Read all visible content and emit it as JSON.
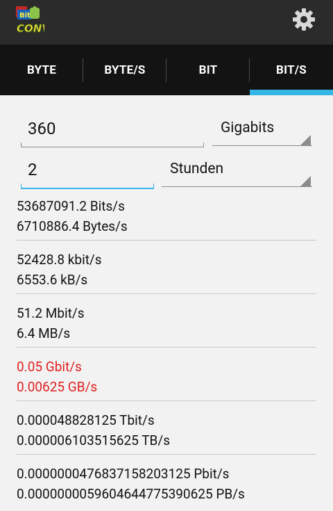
{
  "app": {
    "logo_label": "BitCONV",
    "settings_icon": "gear-icon"
  },
  "tabs": [
    {
      "label": "BYTE",
      "active": false
    },
    {
      "label": "BYTE/S",
      "active": false
    },
    {
      "label": "BIT",
      "active": false
    },
    {
      "label": "BIT/S",
      "active": true
    }
  ],
  "inputs": {
    "amount": {
      "value": "360"
    },
    "amount_unit": {
      "value": "Gigabits"
    },
    "time": {
      "value": "2"
    },
    "time_unit": {
      "value": "Stunden"
    }
  },
  "results": [
    {
      "bits": "53687091.2 Bits/s",
      "bytes": "6710886.4 Bytes/s",
      "highlight": false
    },
    {
      "bits": "52428.8 kbit/s",
      "bytes": "6553.6 kB/s",
      "highlight": false
    },
    {
      "bits": "51.2 Mbit/s",
      "bytes": "6.4 MB/s",
      "highlight": false
    },
    {
      "bits": "0.05 Gbit/s",
      "bytes": "0.00625 GB/s",
      "highlight": true
    },
    {
      "bits": "0.000048828125 Tbit/s",
      "bytes": "0.000006103515625 TB/s",
      "highlight": false
    },
    {
      "bits": "0.0000000476837158203125 Pbit/s",
      "bytes": "0.00000000596046447753906​25 PB/s",
      "highlight": false
    }
  ],
  "colors": {
    "accent": "#33b5e5",
    "highlight": "#e02020",
    "actionbar": "#2b2b2b",
    "tabbar": "#131313"
  }
}
